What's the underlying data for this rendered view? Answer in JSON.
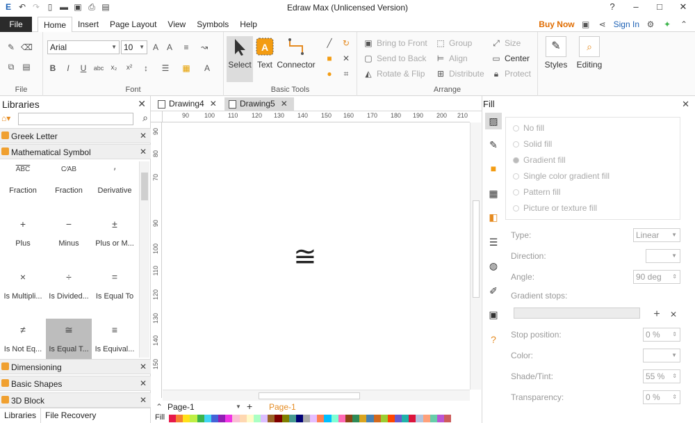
{
  "window": {
    "title": "Edraw Max (Unlicensed Version)",
    "controls": [
      "?",
      "–",
      "□",
      "✕"
    ]
  },
  "menu": {
    "file": "File",
    "tabs": [
      "Home",
      "Insert",
      "Page Layout",
      "View",
      "Symbols",
      "Help"
    ],
    "active_tab": "Home",
    "buy_now": "Buy Now",
    "sign_in": "Sign In"
  },
  "ribbon": {
    "groups": {
      "file": "File",
      "font": "Font",
      "basic_tools": "Basic Tools",
      "arrange": "Arrange"
    },
    "font_name": "Arial",
    "font_size": "10",
    "tools": {
      "select": "Select",
      "text": "Text",
      "connector": "Connector"
    },
    "arrange": {
      "bring_to_front": "Bring to Front",
      "send_to_back": "Send to Back",
      "rotate_flip": "Rotate & Flip",
      "group": "Group",
      "align": "Align",
      "distribute": "Distribute",
      "size": "Size",
      "center": "Center",
      "protect": "Protect"
    },
    "styles": "Styles",
    "editing": "Editing"
  },
  "libraries": {
    "title": "Libraries",
    "categories_top": [
      "Greek Letter",
      "Mathematical Symbol"
    ],
    "categories_bottom": [
      "Dimensioning",
      "Basic Shapes",
      "3D Block"
    ],
    "shapes": [
      {
        "symbol": "ABC",
        "label": "Fraction"
      },
      {
        "symbol": "C⁄AB",
        "label": "Fraction"
      },
      {
        "symbol": "′",
        "label": "Derivative"
      },
      {
        "symbol": "+",
        "label": "Plus"
      },
      {
        "symbol": "−",
        "label": "Minus"
      },
      {
        "symbol": "±",
        "label": "Plus or M..."
      },
      {
        "symbol": "×",
        "label": "Is Multipli..."
      },
      {
        "symbol": "÷",
        "label": "Is Divided..."
      },
      {
        "symbol": "=",
        "label": "Is Equal To"
      },
      {
        "symbol": "≠",
        "label": "Is Not Eq..."
      },
      {
        "symbol": "≅",
        "label": "Is Equal T..."
      },
      {
        "symbol": "≡",
        "label": "Is Equival..."
      }
    ],
    "selected_shape": "Is Equal T...",
    "bottom_tabs": [
      "Libraries",
      "File Recovery"
    ]
  },
  "documents": {
    "tabs": [
      "Drawing4",
      "Drawing5"
    ],
    "active": "Drawing5"
  },
  "ruler": {
    "horizontal": [
      "90",
      "100",
      "110",
      "120",
      "130",
      "140",
      "150",
      "160",
      "170",
      "180",
      "190",
      "200",
      "210"
    ],
    "vertical": [
      "90",
      "80",
      "70",
      "90",
      "100",
      "110",
      "120",
      "130",
      "140",
      "150"
    ]
  },
  "canvas": {
    "symbol": "≅"
  },
  "pages": {
    "page1": "Page-1",
    "page2": "Page-1"
  },
  "palette": {
    "label": "Fill",
    "colors": [
      "#e6194b",
      "#f58231",
      "#ffe119",
      "#bfef45",
      "#3cb44b",
      "#42d4f4",
      "#4363d8",
      "#911eb4",
      "#f032e6",
      "#fabed4",
      "#ffd8b1",
      "#fffac8",
      "#aaffc3",
      "#dcbeff",
      "#9a6324",
      "#800000",
      "#808000",
      "#469990",
      "#000075",
      "#a9a9a9",
      "#e6beff",
      "#ff7f50",
      "#00bfff",
      "#7fffd4",
      "#ff69b4",
      "#8b4513",
      "#2e8b57",
      "#daa520",
      "#4682b4",
      "#d2691e",
      "#9acd32",
      "#ff4500",
      "#6a5acd",
      "#20b2aa",
      "#dc143c",
      "#b0c4de",
      "#ffa07a",
      "#66cdaa",
      "#ba55d3",
      "#cd5c5c"
    ]
  },
  "fill": {
    "title": "Fill",
    "options": [
      "No fill",
      "Solid fill",
      "Gradient fill",
      "Single color gradient fill",
      "Pattern fill",
      "Picture or texture fill"
    ],
    "selected": "Gradient fill",
    "type_label": "Type:",
    "type_value": "Linear",
    "direction_label": "Direction:",
    "angle_label": "Angle:",
    "angle_value": "90 deg",
    "gradient_stops_label": "Gradient stops:",
    "stop_position_label": "Stop position:",
    "stop_position_value": "0 %",
    "color_label": "Color:",
    "shade_label": "Shade/Tint:",
    "shade_value": "55 %",
    "transparency_label": "Transparency:",
    "transparency_value": "0 %"
  }
}
